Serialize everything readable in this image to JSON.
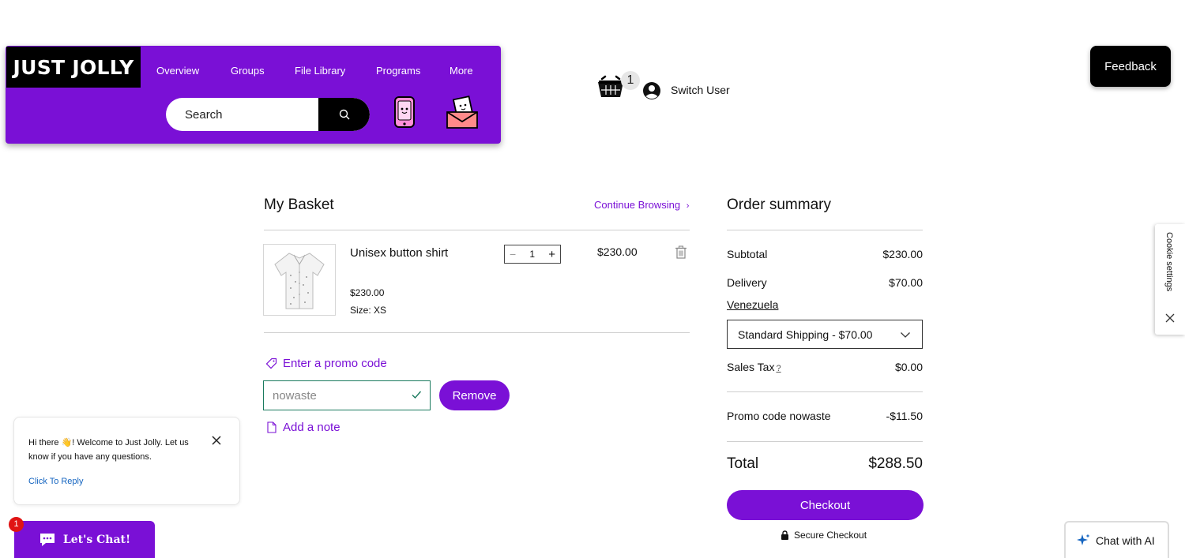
{
  "header": {
    "logo": "JUST JOLLY",
    "nav": [
      "Overview",
      "Groups",
      "File Library",
      "Programs",
      "More"
    ],
    "search_placeholder": "Search",
    "accent_color": "#7a10d6"
  },
  "topbar": {
    "cart_count": "1",
    "switch_user": "Switch User",
    "feedback": "Feedback"
  },
  "basket": {
    "title": "My Basket",
    "continue": "Continue Browsing",
    "item": {
      "name": "Unisex button shirt",
      "price": "$230.00",
      "size": "Size: XS",
      "quantity": "1",
      "line_total": "$230.00",
      "icon": "trash-icon"
    },
    "promo_link": "Enter a promo code",
    "promo_value": "nowaste",
    "remove": "Remove",
    "note_link": "Add a note"
  },
  "summary": {
    "title": "Order summary",
    "subtotal_label": "Subtotal",
    "subtotal": "$230.00",
    "delivery_label": "Delivery",
    "delivery": "$70.00",
    "country": "Venezuela",
    "shipping_option": "Standard Shipping - $70.00",
    "tax_label": "Sales Tax",
    "tax_help": "?",
    "tax": "$0.00",
    "promo_label": "Promo code nowaste",
    "promo": "-$11.50",
    "total_label": "Total",
    "total": "$288.50",
    "checkout": "Checkout",
    "secure": "Secure Checkout"
  },
  "cookie": {
    "label": "Cookie settings"
  },
  "chat": {
    "message": "Hi there 👋! Welcome to Just Jolly. Let us know if you have any questions.",
    "reply": "Click To Reply",
    "button": "Let's Chat!",
    "badge": "1"
  },
  "ai_chat": {
    "label": "Chat with AI"
  }
}
